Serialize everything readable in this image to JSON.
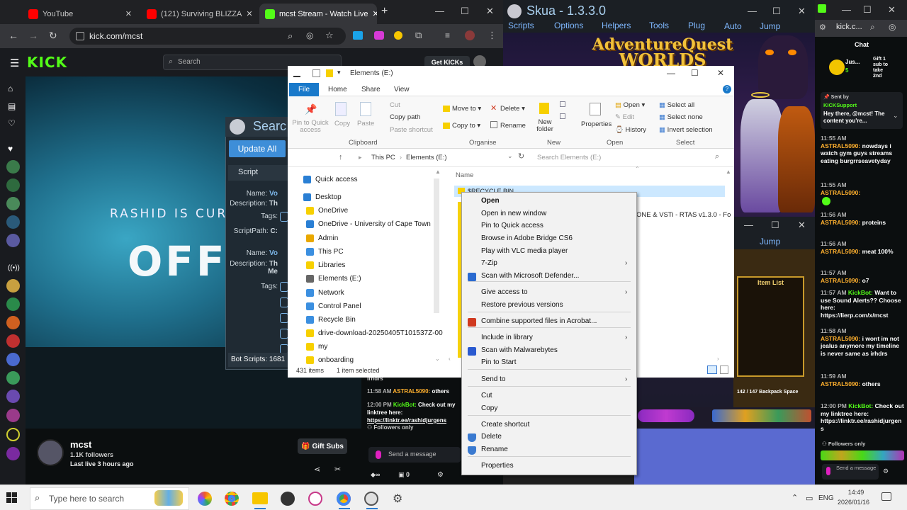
{
  "chrome": {
    "tabs": [
      {
        "label": "YouTube",
        "active": false
      },
      {
        "label": "(121) Surviving BLIZZA",
        "active": false
      },
      {
        "label": "mcst Stream - Watch Live",
        "active": true
      }
    ],
    "new_tab": "+",
    "url": "kick.com/mcst"
  },
  "kick": {
    "logo": "KICK",
    "search_placeholder": "Search",
    "get_kicks": "Get KICKs",
    "offline_subtitle": "RASHID IS CURRE",
    "offline_title": "OFFLIN",
    "channel_name": "mcst",
    "followers": "1.1K followers",
    "last_live": "Last live 3 hours ago",
    "gift_subs": "Gift Subs"
  },
  "skua": {
    "title": "Skua - 1.3.3.0",
    "menu": [
      "Scripts",
      "Options",
      "Helpers",
      "Tools",
      "Plug",
      "Auto",
      "Jump"
    ],
    "menu2": [
      "Jump"
    ],
    "game_logo_line1": "AdventureQuest",
    "game_logo_line2": "WORLDS",
    "item_list": "Item List",
    "backpack": "142 / 147  Backpack Space"
  },
  "script_manager": {
    "title": "Searc",
    "update_all": "Update All",
    "section": "Script",
    "fields": [
      {
        "label": "Name:",
        "value": "Vo"
      },
      {
        "label": "Description:",
        "value": "Th"
      },
      {
        "label": "Tags:",
        "value": ""
      },
      {
        "label": "ScriptPath:",
        "value": "C:"
      },
      {
        "label": "Name:",
        "value": "Vo"
      },
      {
        "label": "Description:",
        "value": "Th Me"
      },
      {
        "label": "Tags:",
        "value": ""
      }
    ],
    "bot_scripts": "Bot Scripts:  1681"
  },
  "explorer": {
    "title": "Elements (E:)",
    "ribbon_tabs": [
      "File",
      "Home",
      "Share",
      "View"
    ],
    "clipboard": {
      "pin": "Pin to Quick access",
      "copy": "Copy",
      "paste": "Paste",
      "cut": "Cut",
      "copy_path": "Copy path",
      "paste_shortcut": "Paste shortcut",
      "group": "Clipboard"
    },
    "organise": {
      "move_to": "Move to",
      "copy_to": "Copy to",
      "delete": "Delete",
      "rename": "Rename",
      "group": "Organise"
    },
    "new": {
      "new_folder": "New folder",
      "group": "New"
    },
    "open": {
      "properties": "Properties",
      "open": "Open",
      "edit": "Edit",
      "history": "History",
      "group": "Open"
    },
    "select": {
      "select_all": "Select all",
      "select_none": "Select none",
      "invert": "Invert selection",
      "group": "Select"
    },
    "breadcrumb": [
      "This PC",
      "Elements (E:)"
    ],
    "search_placeholder": "Search Elements (E:)",
    "column_name": "Name",
    "first_item": "$RECYCLE.BIN",
    "partial_item": "ONE & VSTi - RTAS v1.3.0 - Fo",
    "nav": [
      {
        "label": "Quick access",
        "color": "#2a7fd4"
      },
      {
        "label": "Desktop",
        "color": "#2a7fd4"
      },
      {
        "label": "OneDrive",
        "color": "#f7d000"
      },
      {
        "label": "OneDrive - University of Cape Town",
        "color": "#2a7fd4"
      },
      {
        "label": "Admin",
        "color": "#e9a800"
      },
      {
        "label": "This PC",
        "color": "#3b8fe0"
      },
      {
        "label": "Libraries",
        "color": "#f7d000"
      },
      {
        "label": "Elements (E:)",
        "color": "#666666"
      },
      {
        "label": "Network",
        "color": "#3b8fe0"
      },
      {
        "label": "Control Panel",
        "color": "#3b8fe0"
      },
      {
        "label": "Recycle Bin",
        "color": "#3b8fe0"
      },
      {
        "label": "drive-download-20250405T101537Z-00",
        "color": "#f7d000"
      },
      {
        "label": "my",
        "color": "#f7d000"
      },
      {
        "label": "onboarding",
        "color": "#f7d000"
      }
    ],
    "status_items": "431 items",
    "status_selected": "1 item selected"
  },
  "context_menu": {
    "items": [
      {
        "label": "Open",
        "bold": true,
        "icon": "",
        "arrow": false
      },
      {
        "label": "Open in new window",
        "icon": "",
        "arrow": false
      },
      {
        "label": "Pin to Quick access",
        "icon": "",
        "arrow": false
      },
      {
        "label": "Browse in Adobe Bridge CS6",
        "icon": "",
        "arrow": false
      },
      {
        "label": "Play with VLC media player",
        "icon": "",
        "arrow": false
      },
      {
        "label": "7-Zip",
        "icon": "",
        "arrow": true
      },
      {
        "label": "Scan with Microsoft Defender...",
        "icon": "defender-icon",
        "arrow": false
      },
      {
        "label": "Give access to",
        "icon": "",
        "arrow": true
      },
      {
        "label": "Restore previous versions",
        "icon": "",
        "arrow": false
      },
      {
        "label": "Combine supported files in Acrobat...",
        "icon": "acrobat-icon",
        "arrow": false
      },
      {
        "label": "Include in library",
        "icon": "",
        "arrow": true
      },
      {
        "label": "Scan with Malwarebytes",
        "icon": "malwarebytes-icon",
        "arrow": false
      },
      {
        "label": "Pin to Start",
        "icon": "",
        "arrow": false
      },
      {
        "label": "Send to",
        "icon": "",
        "arrow": true
      },
      {
        "label": "Cut",
        "icon": "",
        "arrow": false
      },
      {
        "label": "Copy",
        "icon": "",
        "arrow": false
      },
      {
        "label": "Create shortcut",
        "icon": "",
        "arrow": false
      },
      {
        "label": "Delete",
        "icon": "shield-icon",
        "arrow": false
      },
      {
        "label": "Rename",
        "icon": "shield-icon",
        "arrow": false
      },
      {
        "label": "Properties",
        "icon": "",
        "arrow": false
      }
    ]
  },
  "middle_chat": {
    "lines": [
      {
        "ts": "11:58 AM",
        "nick": "ASTRAL5090:",
        "msg": "others"
      },
      {
        "ts": "12:00 PM",
        "nick": "KickBot:",
        "msg": "Check out my linktree here:"
      },
      {
        "ts": "",
        "nick": "",
        "msg": "https://linktr.ee/rashidjurgens"
      }
    ],
    "partial_top": "irhdrs",
    "followers_only": "Followers only",
    "send_placeholder": "Send a message",
    "bottom_count": "0"
  },
  "right_chat": {
    "url": "kick.c...",
    "title": "Chat",
    "pinned_nick": "Jus...",
    "pinned_count": "5",
    "pinned_gift": "Gift 1 sub to take 2nd",
    "sent_by": "Sent by",
    "sent_by_nick": "KICKSupport",
    "pinned_msg": "Hey there, @mcst! The content you're...",
    "messages": [
      {
        "ts": "11:55 AM",
        "nick": "ASTRAL5090:",
        "msg": "nowdays i watch gym guys streams eating burgrrseavetyday"
      },
      {
        "ts": "11:55 AM",
        "nick": "ASTRAL5090:",
        "msg": ""
      },
      {
        "ts": "11:56 AM",
        "nick": "ASTRAL5090:",
        "msg": "proteins"
      },
      {
        "ts": "11:56 AM",
        "nick": "ASTRAL5090:",
        "msg": "meat 100%"
      },
      {
        "ts": "11:57 AM",
        "nick": "ASTRAL5090:",
        "msg": "o7"
      },
      {
        "ts": "11:57 AM",
        "nick": "KickBot:",
        "msg": "Want to use Sound Alerts?? Choose here: https://lierp.com/x/mcst"
      },
      {
        "ts": "11:58 AM",
        "nick": "ASTRAL5090:",
        "msg": "i wont im not jealus anymore my timeline is never same as irhdrs"
      },
      {
        "ts": "11:59 AM",
        "nick": "ASTRAL5090:",
        "msg": "others"
      },
      {
        "ts": "12:00 PM",
        "nick": "KickBot:",
        "msg": "Check out my linktree here: https://linktr.ee/rashidjurgen s"
      }
    ],
    "followers_only": "Followers only",
    "send_placeholder": "Send a message"
  },
  "taskbar": {
    "search_placeholder": "Type here to search",
    "lang": "ENG",
    "time": "14:49",
    "date": "2026/01/16"
  }
}
